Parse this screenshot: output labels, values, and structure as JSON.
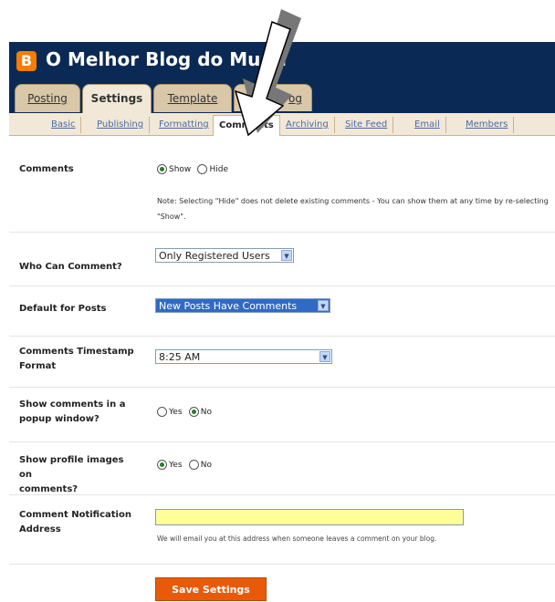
{
  "blog": {
    "title": "O Melhor Blog do Mund",
    "logo_letter": "B"
  },
  "tabs": [
    {
      "label": "Posting",
      "active": false
    },
    {
      "label": "Settings",
      "active": true
    },
    {
      "label": "Template",
      "active": false
    },
    {
      "label": "og",
      "active": false
    }
  ],
  "subtabs": [
    {
      "label": "Basic",
      "active": false
    },
    {
      "label": "Publishing",
      "active": false
    },
    {
      "label": "Formatting",
      "active": false
    },
    {
      "label": "Comments",
      "active": true
    },
    {
      "label": "Archiving",
      "active": false
    },
    {
      "label": "Site Feed",
      "active": false
    },
    {
      "label": "Email",
      "active": false
    },
    {
      "label": "Members",
      "active": false
    }
  ],
  "settings": {
    "comments": {
      "label": "Comments",
      "options": [
        "Show",
        "Hide"
      ],
      "selected": "Show",
      "note_line1": "Note: Selecting \"Hide\" does not delete existing comments - You can show them at any time by re-selecting",
      "note_line2": "\"Show\"."
    },
    "who_can_comment": {
      "label": "Who Can Comment?",
      "value": "Only Registered Users"
    },
    "default_for_posts": {
      "label": "Default for Posts",
      "value": "New Posts Have Comments"
    },
    "timestamp_format": {
      "label_line1": "Comments Timestamp",
      "label_line2": "Format",
      "value": "8:25 AM"
    },
    "popup_window": {
      "label_line1": "Show comments in a",
      "label_line2": "popup window?",
      "options": [
        "Yes",
        "No"
      ],
      "selected": "No"
    },
    "profile_images": {
      "label_line1": "Show profile images on",
      "label_line2": "comments?",
      "options": [
        "Yes",
        "No"
      ],
      "selected": "Yes"
    },
    "notification": {
      "label_line1": "Comment Notification",
      "label_line2": "Address",
      "value": "",
      "helper": "We will email you at this address when someone leaves a comment on your blog."
    }
  },
  "save_label": "Save Settings",
  "colors": {
    "header": "#0a2a55",
    "tab": "#d9c7a8",
    "save": "#e85a0a",
    "input_highlight": "#ffff99"
  }
}
